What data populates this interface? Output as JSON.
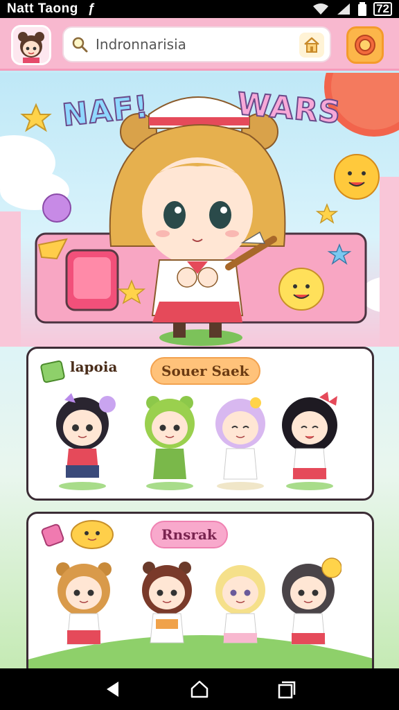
{
  "status_bar": {
    "title": "Natt Taong",
    "extra": "ƒ",
    "time": "72"
  },
  "header": {
    "search_value": "Indronnarisia",
    "search_placeholder": "Indronnarisia"
  },
  "hero": {
    "title_left": "NAF!",
    "title_right": "WARS"
  },
  "card_1": {
    "tag": "lapoia",
    "pill": "Souer Saek"
  },
  "card_2": {
    "pill": "Rnsrak"
  },
  "colors": {
    "header": "#f8b8cf",
    "accent_pink": "#f8a6c3",
    "accent_orange": "#fcb64a",
    "card_border": "#3b2c35"
  },
  "icons": [
    "search-icon",
    "home-icon",
    "menu-icon",
    "wifi-icon",
    "signal-icon",
    "battery-icon",
    "back-icon",
    "home-nav-icon",
    "recents-icon"
  ]
}
